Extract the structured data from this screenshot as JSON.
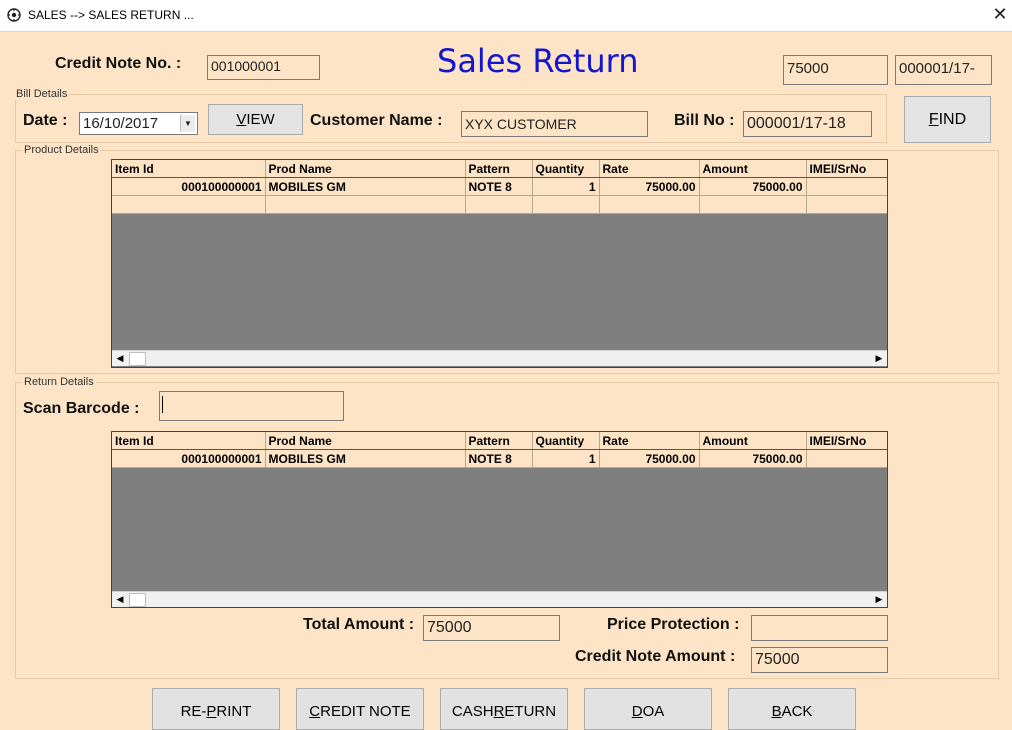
{
  "window": {
    "title": "SALES --> SALES RETURN ...",
    "close": "✕"
  },
  "header": {
    "credit_note_label": "Credit Note No. :",
    "credit_note_value": "001000001",
    "heading": "Sales Return",
    "box1": "75000",
    "box2": "000001/17-"
  },
  "bill_details": {
    "group_label": "Bill Details",
    "date_label": "Date :",
    "date_value": "16/10/2017",
    "view_button": {
      "pre": "",
      "ul": "V",
      "post": "IEW"
    },
    "customer_label": "Customer Name :",
    "customer_value": "XYX CUSTOMER",
    "bill_label": "Bill No :",
    "bill_value": "000001/17-18"
  },
  "find_button": {
    "pre": "",
    "ul": "F",
    "post": "IND"
  },
  "product_details": {
    "group_label": "Product Details",
    "columns": [
      "Item Id",
      "Prod Name",
      "Pattern",
      "Quantity",
      "Rate",
      "Amount",
      "IMEI/SrNo"
    ],
    "rows": [
      [
        "000100000001",
        "MOBILES GM",
        "NOTE 8",
        "1",
        "75000.00",
        "75000.00",
        ""
      ]
    ]
  },
  "return_details": {
    "group_label": "Return Details",
    "scan_label": "Scan Barcode :",
    "scan_value": "",
    "columns": [
      "Item Id",
      "Prod Name",
      "Pattern",
      "Quantity",
      "Rate",
      "Amount",
      "IMEI/SrNo"
    ],
    "rows": [
      [
        "000100000001",
        "MOBILES GM",
        "NOTE 8",
        "1",
        "75000.00",
        "75000.00",
        ""
      ]
    ]
  },
  "totals": {
    "total_label": "Total Amount :",
    "total_value": "75000",
    "price_protection_label": "Price Protection :",
    "price_protection_value": "",
    "credit_note_amount_label": "Credit Note Amount :",
    "credit_note_amount_value": "75000"
  },
  "footer_buttons": [
    {
      "pre": "RE-",
      "ul": "P",
      "post": "RINT"
    },
    {
      "pre": "",
      "ul": "C",
      "post": "REDIT NOTE"
    },
    {
      "pre": "CASH ",
      "ul": "R",
      "post": "ETURN"
    },
    {
      "pre": "",
      "ul": "D",
      "post": "OA"
    },
    {
      "pre": "",
      "ul": "B",
      "post": "ACK"
    }
  ]
}
